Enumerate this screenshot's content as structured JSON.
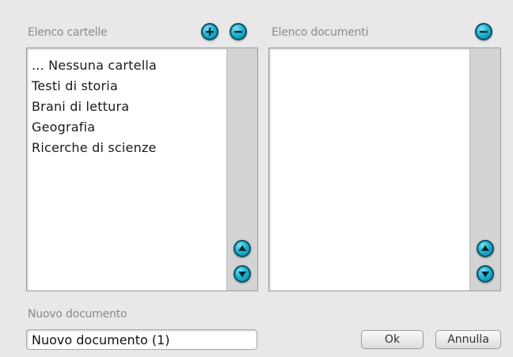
{
  "folders": {
    "label": "Elenco cartelle",
    "items": [
      "... Nessuna cartella",
      "Testi di storia",
      "Brani di lettura",
      "Geografia",
      "Ricerche di scienze"
    ]
  },
  "documents": {
    "label": "Elenco documenti",
    "items": []
  },
  "new_document": {
    "label": "Nuovo documento",
    "value": "Nuovo documento (1)"
  },
  "buttons": {
    "ok": "Ok",
    "cancel": "Annulla"
  },
  "icons": {
    "add": "plus-icon",
    "remove": "minus-icon",
    "scroll_up": "arrow-up-icon",
    "scroll_down": "arrow-down-icon"
  },
  "colors": {
    "accent": "#1fb4d0",
    "background": "#e8e8e8"
  }
}
